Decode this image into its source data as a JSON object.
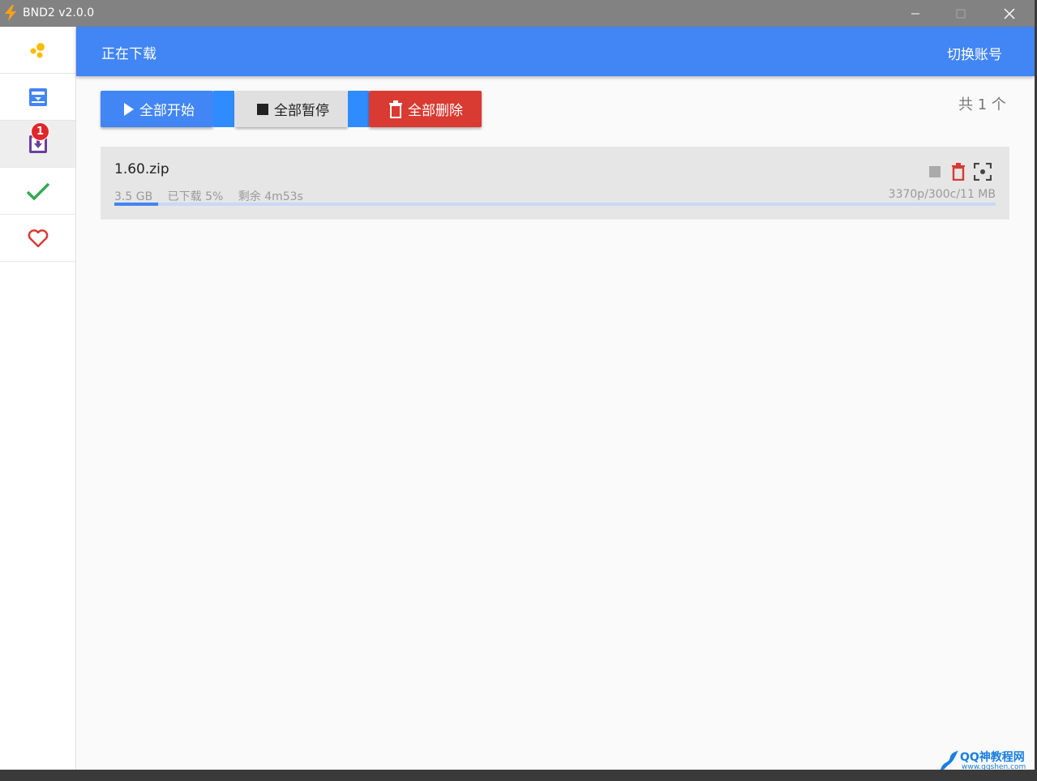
{
  "window": {
    "title": "BND2 v2.0.0"
  },
  "sidebar": {
    "items": [
      {
        "name": "logo",
        "icon": "bubbles-icon"
      },
      {
        "name": "library",
        "icon": "inbox-tray-icon"
      },
      {
        "name": "downloading",
        "icon": "download-box-icon",
        "badge": "1"
      },
      {
        "name": "completed",
        "icon": "checkmark-icon"
      },
      {
        "name": "favorites",
        "icon": "heart-icon"
      }
    ]
  },
  "header": {
    "title": "正在下载",
    "switch_account": "切换账号"
  },
  "toolbar": {
    "start_all": "全部开始",
    "pause_all": "全部暂停",
    "delete_all": "全部删除",
    "count": "共 1 个"
  },
  "downloads": [
    {
      "filename": "1.60.zip",
      "size": "3.5 GB",
      "downloaded": "已下载 5%",
      "remaining": "剩余 4m53s",
      "stats": "3370p/300c/11 MB",
      "progress": 0.05
    }
  ],
  "watermark": {
    "line1": "QQ神教程网",
    "line2": "www.qqshen.com"
  },
  "colors": {
    "accent": "#4285f4",
    "danger": "#d93a32",
    "titlebar": "#828282"
  }
}
